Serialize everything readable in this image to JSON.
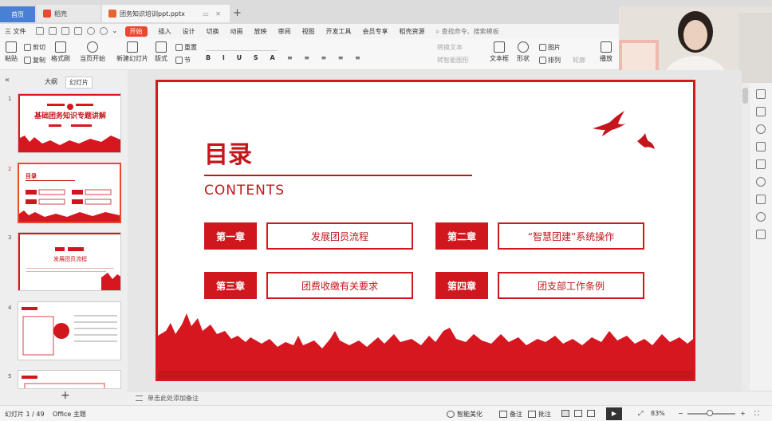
{
  "tabs": {
    "home": "首页",
    "wps": "稻壳",
    "doc": "团务知识培训ppt.pptx"
  },
  "menu": {
    "file": "三 文件",
    "tabs": [
      "开始",
      "插入",
      "设计",
      "切换",
      "动画",
      "放映",
      "审阅",
      "视图",
      "开发工具",
      "会员专享",
      "稻壳资源"
    ],
    "active_index": 0,
    "search": "查找命令、搜索模板"
  },
  "ribbon": {
    "paste": "粘贴",
    "cut": "剪切",
    "copy": "复制",
    "format": "格式刷",
    "from_current": "当页开始",
    "new_slide": "新建幻灯片",
    "layout": "版式",
    "section": "节",
    "reset": "重置",
    "text_box": "文本框",
    "shape": "形状",
    "arrange": "排列",
    "picture": "图片",
    "outline": "轮廓",
    "play": "播放",
    "smart": "转智能图形",
    "convert": "转换文本"
  },
  "panel": {
    "outline_tab": "大纲",
    "slides_tab": "幻灯片",
    "thumbs": [
      {
        "num": "1",
        "title": "基础团务知识专题讲解"
      },
      {
        "num": "2",
        "title": "目录"
      },
      {
        "num": "3",
        "title": "发展团员流程"
      },
      {
        "num": "4",
        "title": ""
      },
      {
        "num": "5",
        "title": ""
      }
    ]
  },
  "slide": {
    "title": "目录",
    "subtitle": "CONTENTS",
    "chapters": [
      {
        "label": "第一章",
        "text": "发展团员流程"
      },
      {
        "label": "第二章",
        "text": "“智慧团建”系统操作"
      },
      {
        "label": "第三章",
        "text": "团费收缴有关要求"
      },
      {
        "label": "第四章",
        "text": "团支部工作条例"
      }
    ]
  },
  "notes_placeholder": "单击此处添加备注",
  "status": {
    "slide_count": "幻灯片 1 / 49",
    "theme": "Office 主题",
    "beautify": "智能美化",
    "notes": "备注",
    "comments": "批注",
    "zoom": "83%"
  },
  "colors": {
    "accent": "#d0171e",
    "tab_active": "#4a7fd6",
    "menu_active": "#e8492f"
  }
}
